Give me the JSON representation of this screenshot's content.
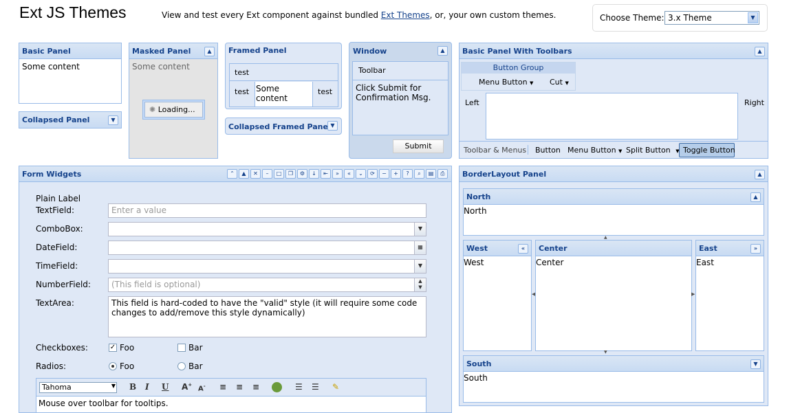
{
  "header": {
    "title": "Ext JS Themes",
    "intro_prefix": "View and test every Ext component against bundled ",
    "intro_link": "Ext Themes",
    "intro_suffix": ", or, your own custom themes.",
    "theme_label": "Choose Theme:",
    "theme_value": "3.x Theme"
  },
  "basic_panel": {
    "title": "Basic Panel",
    "content": "Some content"
  },
  "collapsed_panel": {
    "title": "Collapsed Panel"
  },
  "masked_panel": {
    "title": "Masked Panel",
    "content": "Some content",
    "loading": "Loading..."
  },
  "framed_panel": {
    "title": "Framed Panel",
    "top": "test",
    "left": "test",
    "center": "Some content",
    "right": "test"
  },
  "collapsed_framed": {
    "title": "Collapsed Framed Panel"
  },
  "window": {
    "title": "Window",
    "toolbar": "Toolbar",
    "content": "Click Submit for Confirmation Msg.",
    "submit": "Submit"
  },
  "toolbars_panel": {
    "title": "Basic Panel With Toolbars",
    "group_title": "Button Group",
    "menu_button": "Menu Button",
    "cut": "Cut",
    "left": "Left",
    "right": "Right",
    "bottom": {
      "label": "Toolbar & Menus",
      "button": "Button",
      "menu_button": "Menu Button",
      "split_button": "Split Button",
      "toggle_button": "Toggle Button"
    }
  },
  "form": {
    "title": "Form Widgets",
    "plain_label": "Plain Label",
    "textfield_label": "TextField:",
    "textfield_placeholder": "Enter a value",
    "combo_label": "ComboBox:",
    "date_label": "DateField:",
    "time_label": "TimeField:",
    "number_label": "NumberField:",
    "number_placeholder": "(This field is optional)",
    "textarea_label": "TextArea:",
    "textarea_value": "This field is hard-coded to have the \"valid\" style (it will require some code changes to add/remove this style dynamically)",
    "checkboxes_label": "Checkboxes:",
    "checkbox_foo": "Foo",
    "checkbox_bar": "Bar",
    "radios_label": "Radios:",
    "radio_foo": "Foo",
    "radio_bar": "Bar",
    "font_value": "Tahoma",
    "editor_text": "Mouse over toolbar for tooltips."
  },
  "border_layout": {
    "title": "BorderLayout Panel",
    "north_title": "North",
    "north": "North",
    "west_title": "West",
    "west": "West",
    "center_title": "Center",
    "center": "Center",
    "east_title": "East",
    "east": "East",
    "south_title": "South",
    "south": "South"
  }
}
